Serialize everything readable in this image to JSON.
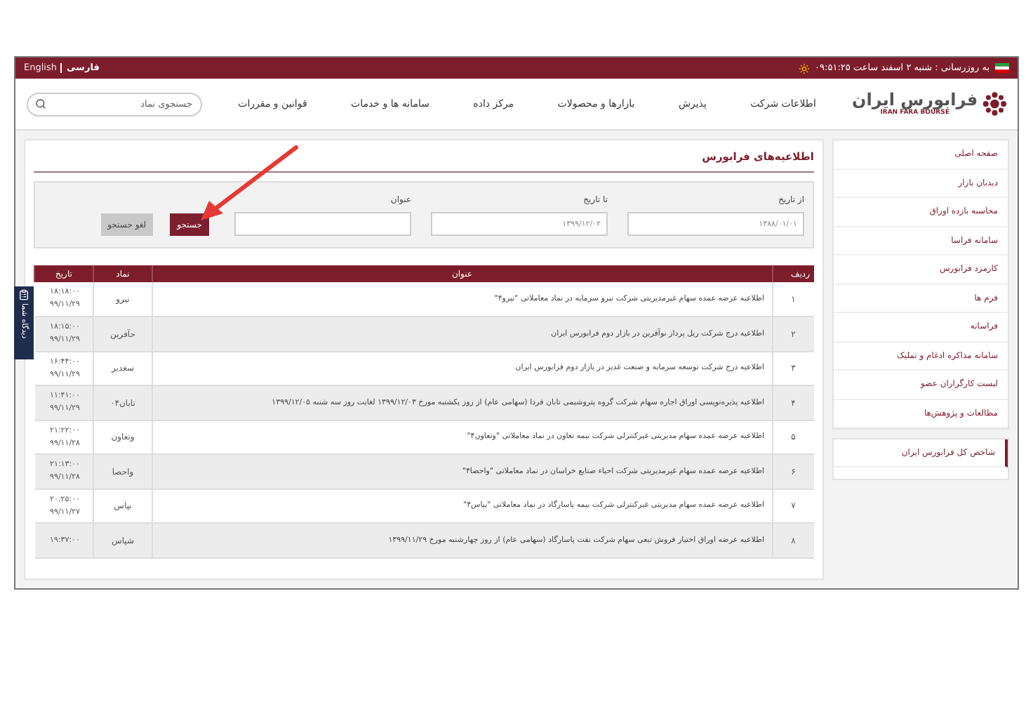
{
  "top_bar": {
    "update_text": "به روزرسانی : شنبه ۲ اسفند ساعت ۰۹:۵۱:۲۵",
    "languages": [
      {
        "label": "فارسی",
        "selected": true
      },
      {
        "label": "English",
        "selected": false
      }
    ]
  },
  "logo": {
    "name": "فرابورس ایران",
    "latin": "IRAN FARA BOURSE"
  },
  "nav": [
    "اطلاعات شرکت",
    "پذیرش",
    "بازارها و محصولات",
    "مرکز داده",
    "سامانه ها و خدمات",
    "قوانین و مقررات"
  ],
  "search": {
    "placeholder": "جستجوی نماد"
  },
  "sidebar": {
    "items": [
      "صفحه اصلی",
      "دیدبان بازار",
      "محاسبه بازده اوراق",
      "سامانه فراسا",
      "کارمزد فرابورس",
      "فرم ها",
      "فراسانه",
      "سامانه مذاکره ادغام و تملیک",
      "لیست کارگزاران عضو",
      "مطالعات و پژوهش‌ها"
    ],
    "index_item": {
      "label": "شاخص کل فرابورس ایران",
      "selected": true
    }
  },
  "panel": {
    "title": "اطلاعیه‌های فرابورس",
    "filters": [
      {
        "label": "از تاریخ",
        "value": "۱۳۸۸/۰۱/۰۱"
      },
      {
        "label": "تا تاریخ",
        "value": "۱۳۹۹/۱۲/۰۲"
      },
      {
        "label": "عنوان"
      }
    ],
    "buttons": [
      {
        "label": "جستجو",
        "kind": "primary"
      },
      {
        "label": "لغو جستجو",
        "kind": "secondary"
      }
    ],
    "table": {
      "columns": [
        "ردیف",
        "عنوان",
        "نماد",
        "تاریخ"
      ],
      "rows": [
        {
          "index": "۱",
          "title": "اطلاعیه عرضه عمده سهام غیرمدیریتی شرکت نیرو سرمایه در نماد معاملاتی \"نیرو۴\"",
          "symbol": "نیرو",
          "time": "۱۸:۱۸:۰۰",
          "date": "۹۹/۱۱/۲۹"
        },
        {
          "index": "۲",
          "title": "اطلاعیه درج شرکت ریل پرداز نوآفرین در بازار دوم فرابورس ایران",
          "symbol": "حآفرین",
          "time": "۱۸:۱۵:۰۰",
          "date": "۹۹/۱۱/۲۹"
        },
        {
          "index": "۳",
          "title": "اطلاعیه درج شرکت توسعه سرمایه و صنعت غدیر در بازار دوم فرابورس ایران",
          "symbol": "سغدیر",
          "time": "۱۶:۴۴:۰۰",
          "date": "۹۹/۱۱/۲۹"
        },
        {
          "index": "۴",
          "title": "اطلاعیه پذیره‌نویسی اوراق اجاره سهام شرکت گروه پتروشیمی تابان فردا (سهامی عام) از روز یکشنبه مورخ ۱۳۹۹/۱۲/۰۳ لغایت روز سه شنبه ۱۳۹۹/۱۲/۰۵",
          "symbol": "تابان۰۴",
          "time": "۱۱:۴۱:۰۰",
          "date": "۹۹/۱۱/۲۹"
        },
        {
          "index": "۵",
          "title": "اطلاعیه عرضه عمده سهام مدیریتی غیرکنترلی شرکت بیمه تعاون در نماد معاملاتی \"وتعاون۴\"",
          "symbol": "وتعاون",
          "time": "۲۱:۲۲:۰۰",
          "date": "۹۹/۱۱/۲۸"
        },
        {
          "index": "۶",
          "title": "اطلاعیه عرضه عمده سهام غیرمدیریتی شرکت احیاء صنایع خراسان در نماد معاملاتی \"واحصا۴\"",
          "symbol": "واحصا",
          "time": "۲۱:۱۳:۰۰",
          "date": "۹۹/۱۱/۲۸"
        },
        {
          "index": "۷",
          "title": "اطلاعیه عرضه عمده سهام مدیریتی غیرکنترلی شرکت بیمه پاسارگاد در نماد معاملاتی \"بپاس۴\"",
          "symbol": "بپاس",
          "time": "۲۰:۲۵:۰۰",
          "date": "۹۹/۱۱/۲۷"
        },
        {
          "index": "۸",
          "title": "اطلاعیه عرضه اوراق اختیار فروش تبعی سهام شرکت نفت پاسارگاد (سهامی عام) از روز چهارشنبه مورخ ۱۳۹۹/۱۱/۲۹",
          "symbol": "شپاس",
          "time": "۱۹:۳۷:۰۰"
        }
      ]
    }
  },
  "feedback_tab": {
    "label": "دیدگاه شما"
  }
}
